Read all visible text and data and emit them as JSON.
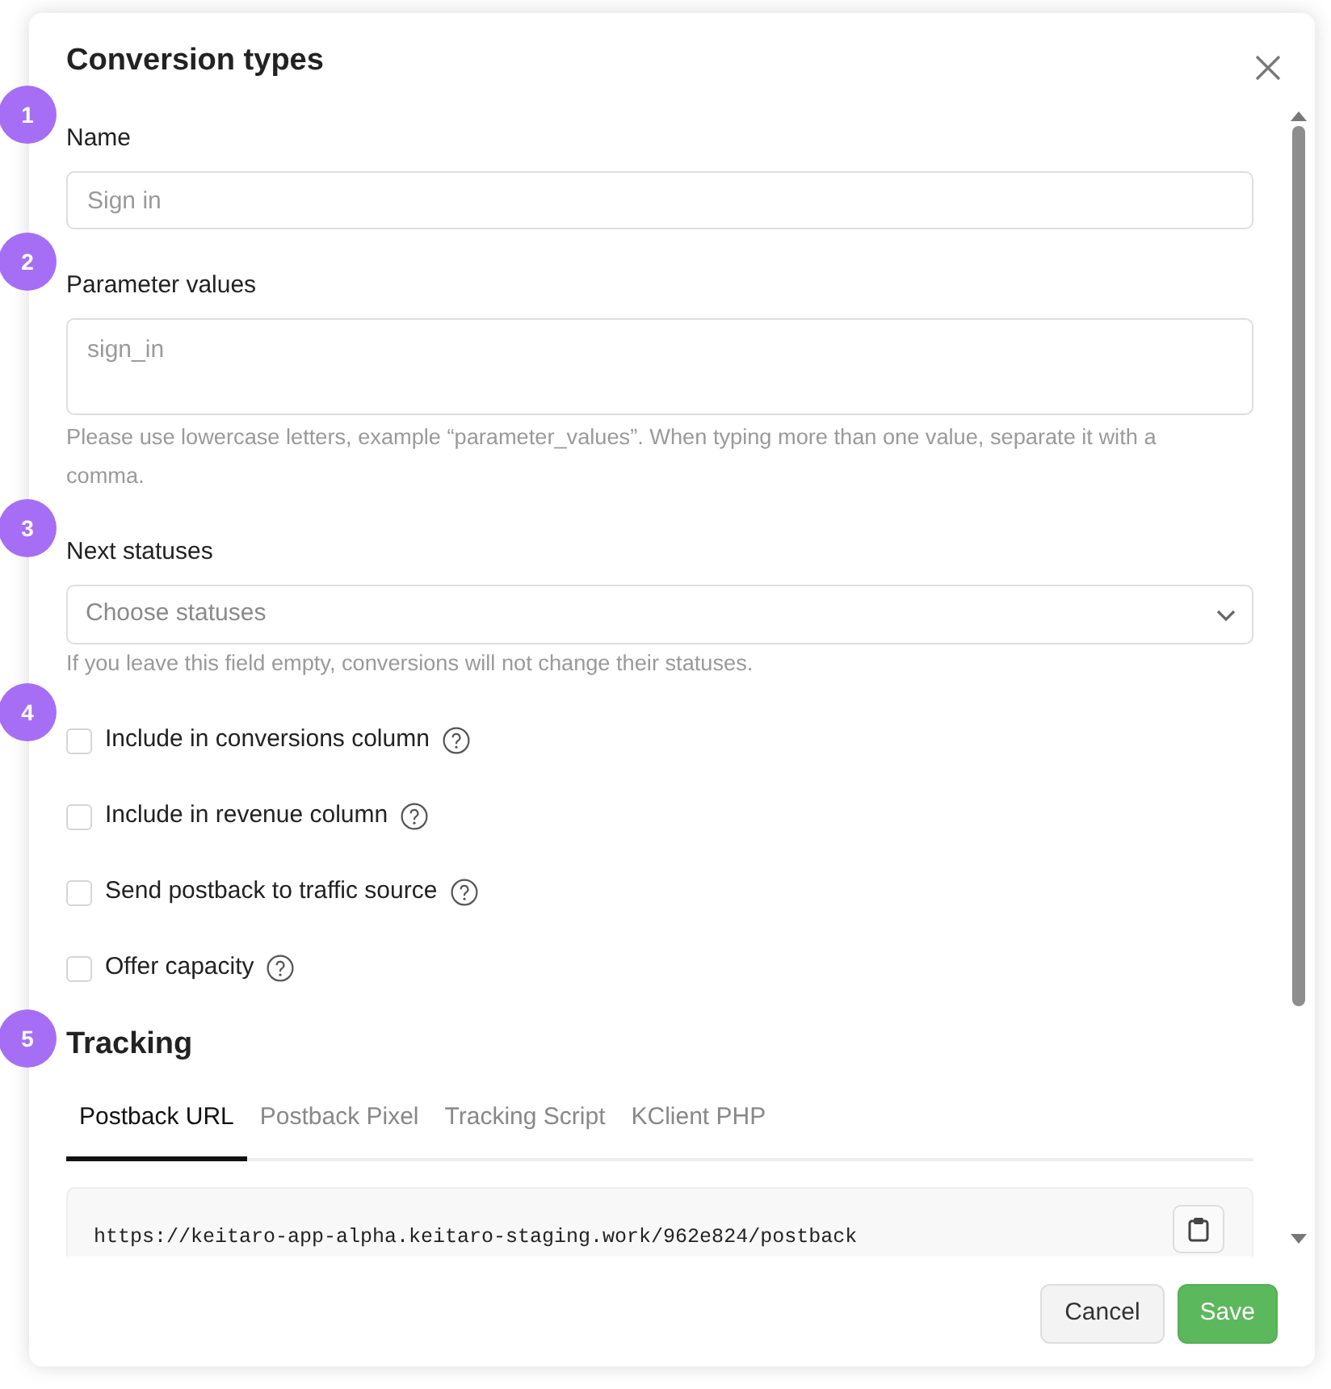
{
  "dialog": {
    "title": "Conversion types"
  },
  "fields": [
    {
      "kind": "text",
      "callout": "1",
      "label": "Name",
      "placeholder": "Sign in"
    },
    {
      "kind": "textarea",
      "callout": "2",
      "label": "Parameter values",
      "placeholder": "sign_in",
      "help": "Please use lowercase letters, example “parameter_values”. When typing more than one value, separate it with a comma."
    },
    {
      "kind": "select",
      "callout": "3",
      "label": "Next statuses",
      "placeholder": "Choose statuses",
      "help": "If you leave this field empty, conversions will not change their statuses."
    }
  ],
  "options_callout": "4",
  "options": [
    {
      "label": "Include in conversions column",
      "checked": false
    },
    {
      "label": "Include in revenue column",
      "checked": false
    },
    {
      "label": "Send postback to traffic source",
      "checked": false
    },
    {
      "label": "Offer capacity",
      "checked": false
    }
  ],
  "tracking": {
    "callout": "5",
    "title": "Tracking",
    "tabs": [
      {
        "label": "Postback URL",
        "selected": true
      },
      {
        "label": "Postback Pixel",
        "selected": false
      },
      {
        "label": "Tracking Script",
        "selected": false
      },
      {
        "label": "KClient PHP",
        "selected": false
      }
    ],
    "url": "https://keitaro-app-alpha.keitaro-staging.work/962e824/postback"
  },
  "buttons": [
    {
      "label": "Cancel",
      "kind": "secondary"
    },
    {
      "label": "Save",
      "kind": "primary"
    }
  ]
}
